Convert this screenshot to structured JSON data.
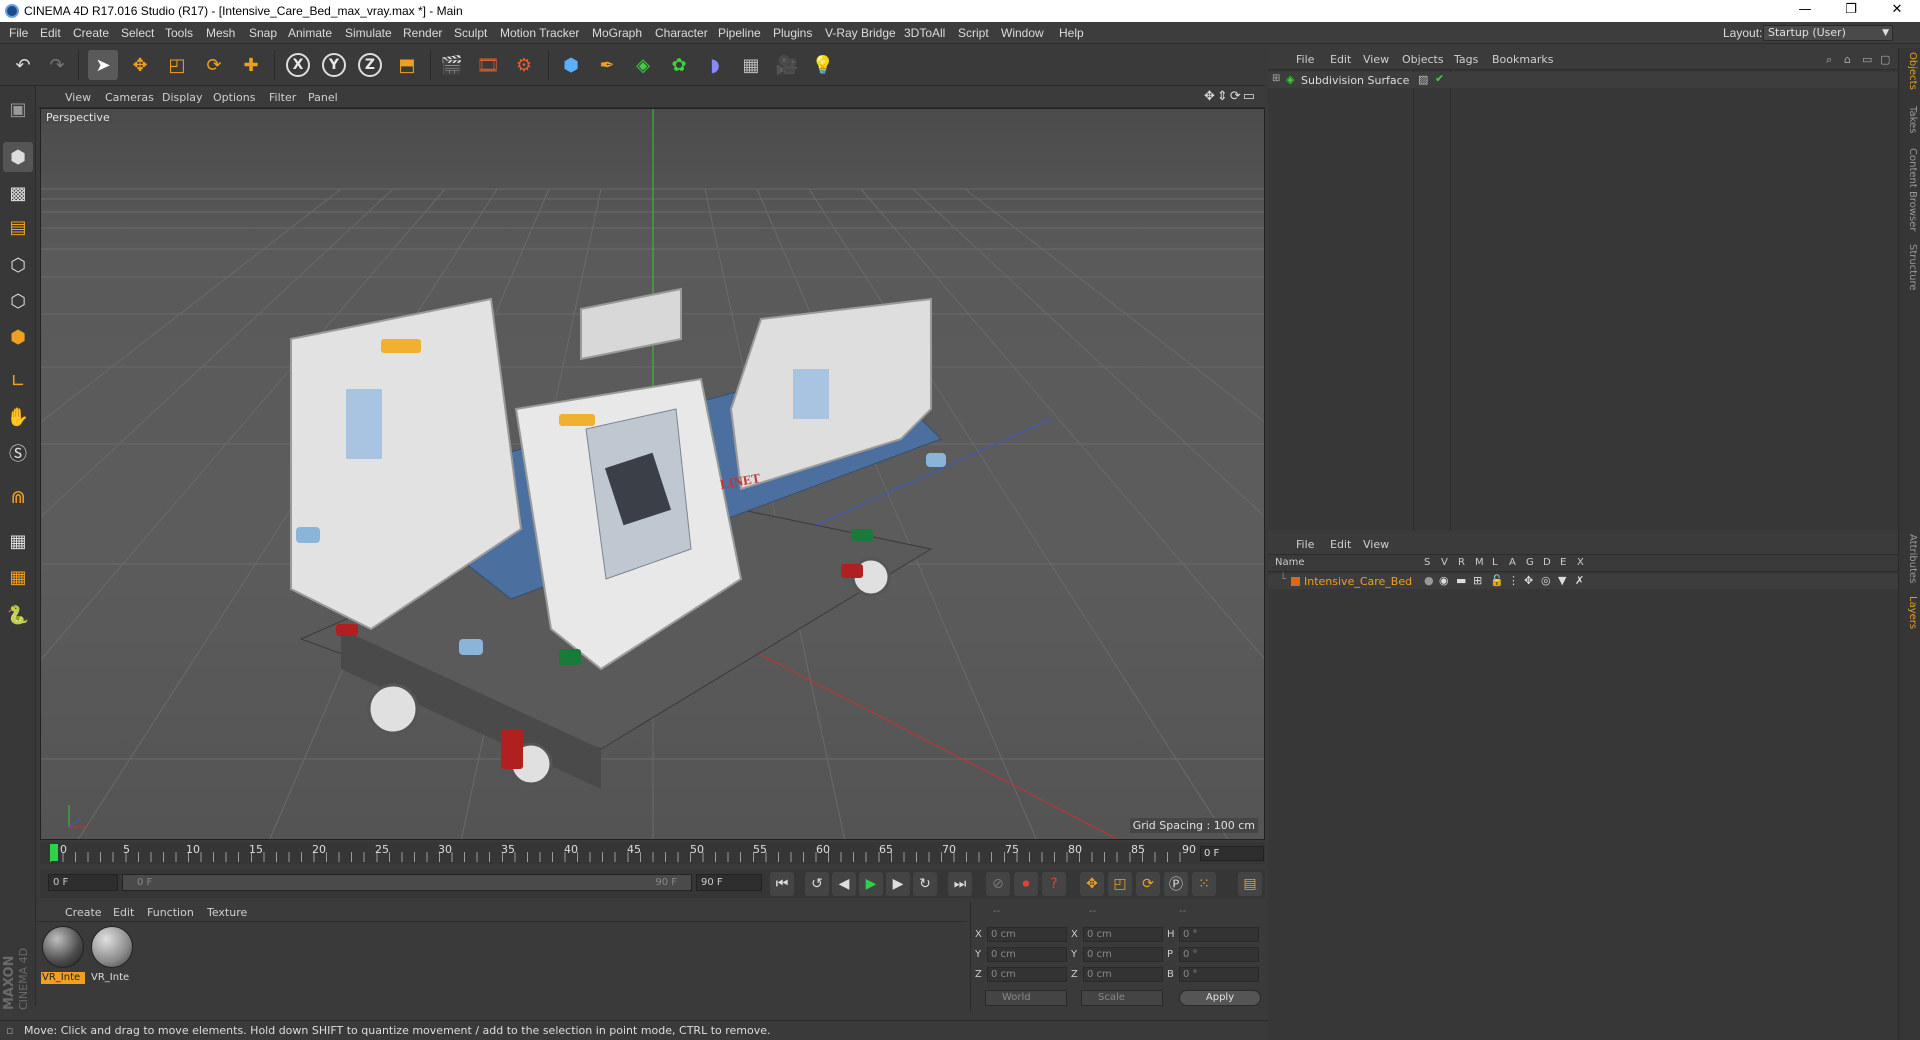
{
  "window": {
    "title": "CINEMA 4D R17.016 Studio (R17) - [Intensive_Care_Bed_max_vray.max *] - Main",
    "controls": [
      "—",
      "❐",
      "✕"
    ]
  },
  "menubar": {
    "items": [
      "File",
      "Edit",
      "Create",
      "Select",
      "Tools",
      "Mesh",
      "Snap",
      "Animate",
      "Simulate",
      "Render",
      "Sculpt",
      "Motion Tracker",
      "MoGraph",
      "Character",
      "Pipeline",
      "Plugins",
      "V-Ray Bridge",
      "3DToAll",
      "Script",
      "Window",
      "Help"
    ],
    "layout_label": "Layout:",
    "layout_value": "Startup (User)"
  },
  "toolbar": {
    "buttons": [
      "undo-icon",
      "redo-icon",
      "select-icon",
      "move-icon",
      "scale-icon",
      "rotate-icon",
      "add-icon",
      "x-axis-icon",
      "y-axis-icon",
      "z-axis-icon",
      "coordinate-system-icon",
      "render-view-icon",
      "render-picture-viewer-icon",
      "edit-render-settings-icon",
      "cube-icon",
      "pen-icon",
      "subdivision-icon",
      "array-icon",
      "deformer-icon",
      "floor-icon",
      "camera-icon",
      "light-icon"
    ],
    "axis_labels": [
      "X",
      "Y",
      "Z"
    ]
  },
  "viewport": {
    "menu": [
      "View",
      "Cameras",
      "Display",
      "Options",
      "Filter",
      "Panel"
    ],
    "label": "Perspective",
    "grid_spacing": "Grid Spacing : 100 cm",
    "logo_text": "LINET"
  },
  "timeline": {
    "ticks": [
      "0",
      "5",
      "10",
      "15",
      "20",
      "25",
      "30",
      "35",
      "40",
      "45",
      "50",
      "55",
      "60",
      "65",
      "70",
      "75",
      "80",
      "85",
      "90"
    ],
    "current_frame": "0 F",
    "start_field": "0 F",
    "range_start": "0 F",
    "range_end": "90 F",
    "end_field": "90 F"
  },
  "materials": {
    "menu": [
      "Create",
      "Edit",
      "Function",
      "Texture"
    ],
    "items": [
      {
        "label": "VR_Inte",
        "selected": true
      },
      {
        "label": "VR_Inte",
        "selected": false
      }
    ]
  },
  "coordinates": {
    "headers": [
      "--",
      "--",
      "--"
    ],
    "rows": [
      {
        "a": "X",
        "av": "0 cm",
        "b": "X",
        "bv": "0 cm",
        "c": "H",
        "cv": "0 °"
      },
      {
        "a": "Y",
        "av": "0 cm",
        "b": "Y",
        "bv": "0 cm",
        "c": "P",
        "cv": "0 °"
      },
      {
        "a": "Z",
        "av": "0 cm",
        "b": "Z",
        "bv": "0 cm",
        "c": "B",
        "cv": "0 °"
      }
    ],
    "world": "World",
    "scale": "Scale",
    "apply": "Apply"
  },
  "maxon": {
    "line1": "MAXON",
    "line2": "CINEMA 4D"
  },
  "status": "Move: Click and drag to move elements. Hold down SHIFT to quantize movement / add to the selection in point mode, CTRL to remove.",
  "objects_panel": {
    "menu": [
      "File",
      "Edit",
      "View",
      "Objects",
      "Tags",
      "Bookmarks"
    ],
    "items": [
      {
        "name": "Subdivision Surface"
      }
    ]
  },
  "layers_panel": {
    "menu": [
      "File",
      "Edit",
      "View"
    ],
    "columns": [
      "Name",
      "S",
      "V",
      "R",
      "M",
      "L",
      "A",
      "G",
      "D",
      "E",
      "X"
    ],
    "items": [
      {
        "name": "Intensive_Care_Bed",
        "color": "#d9681c"
      }
    ]
  },
  "side_tabs": [
    "Objects",
    "Takes",
    "Content Browser",
    "Structure",
    "Attributes",
    "Layers"
  ],
  "colors": {
    "accent": "#f0a020",
    "x_axis": "#c83232",
    "y_axis": "#32c832",
    "z_axis": "#3c5ac8"
  }
}
